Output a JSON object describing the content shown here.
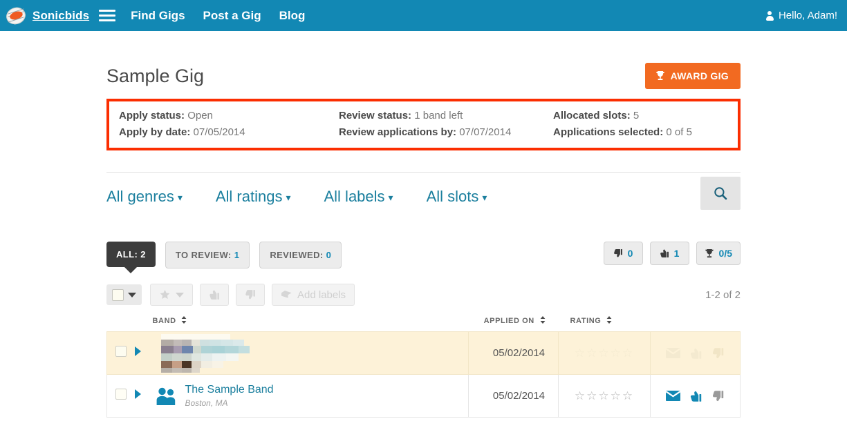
{
  "nav": {
    "logo_icon": "sonicbids-logo-icon",
    "brand": "Sonicbids",
    "menu_icon": "hamburger-menu-icon",
    "links": [
      {
        "label": "Find Gigs"
      },
      {
        "label": "Post a Gig"
      },
      {
        "label": "Blog"
      }
    ],
    "user_icon": "person-icon",
    "greeting": "Hello, Adam!",
    "background_color": "#1288b4"
  },
  "header": {
    "title": "Sample Gig",
    "award_button": {
      "label": "AWARD GIG",
      "icon": "trophy-icon",
      "color": "#f26a21"
    }
  },
  "status_box": {
    "highlight_color": "#fb2e01",
    "columns": [
      [
        {
          "label": "Apply status:",
          "value": "Open"
        },
        {
          "label": "Apply by date:",
          "value": "07/05/2014"
        }
      ],
      [
        {
          "label": "Review status:",
          "value": "1 band left"
        },
        {
          "label": "Review applications by:",
          "value": "07/07/2014"
        }
      ],
      [
        {
          "label": "Allocated slots:",
          "value": "5"
        },
        {
          "label": "Applications selected:",
          "value": "0 of 5"
        }
      ]
    ]
  },
  "filters": {
    "items": [
      {
        "label": "All genres",
        "icon": "chevron-down-icon"
      },
      {
        "label": "All ratings",
        "icon": "chevron-down-icon"
      },
      {
        "label": "All labels",
        "icon": "chevron-down-icon"
      },
      {
        "label": "All slots",
        "icon": "chevron-down-icon"
      }
    ],
    "search_icon": "search-icon",
    "accent_color": "#1b7f9e"
  },
  "tabs": [
    {
      "label": "ALL:",
      "count": "2",
      "active": true
    },
    {
      "label": "TO REVIEW:",
      "count": "1",
      "active": false
    },
    {
      "label": "REVIEWED:",
      "count": "0",
      "active": false
    }
  ],
  "stats": [
    {
      "icon": "thumbs-down-icon",
      "value": "0"
    },
    {
      "icon": "thumbs-up-icon",
      "value": "1"
    },
    {
      "icon": "trophy-icon",
      "value": "0/5"
    }
  ],
  "toolbar": {
    "select_all_icon": "checkbox-dropdown-icon",
    "star_label": "",
    "star_icon": "star-icon",
    "thumbs_up_icon": "thumbs-up-icon",
    "thumbs_down_icon": "thumbs-down-icon",
    "add_labels_label": "Add labels",
    "add_labels_icon": "tag-icon",
    "pagination": "1-2 of 2"
  },
  "table": {
    "headers": [
      {
        "label": "BAND",
        "sort_icon": "sort-icon"
      },
      {
        "label": "APPLIED ON",
        "sort_icon": "sort-icon"
      },
      {
        "label": "RATING",
        "sort_icon": "sort-icon"
      }
    ],
    "rows": [
      {
        "redacted": true,
        "band_name": "",
        "band_location": "",
        "applied_on": "05/02/2014",
        "rating": "☆☆☆☆☆",
        "expand_icon": "expand-triangle-icon",
        "actions": [
          "mail-icon",
          "thumbs-up-icon",
          "thumbs-down-icon"
        ]
      },
      {
        "redacted": false,
        "band_name": "The Sample Band",
        "band_location": "Boston, MA",
        "applied_on": "05/02/2014",
        "rating": "☆☆☆☆☆",
        "expand_icon": "expand-triangle-icon",
        "avatar_icon": "two-people-icon",
        "actions": [
          "mail-icon",
          "thumbs-up-icon",
          "thumbs-down-icon"
        ]
      }
    ]
  }
}
